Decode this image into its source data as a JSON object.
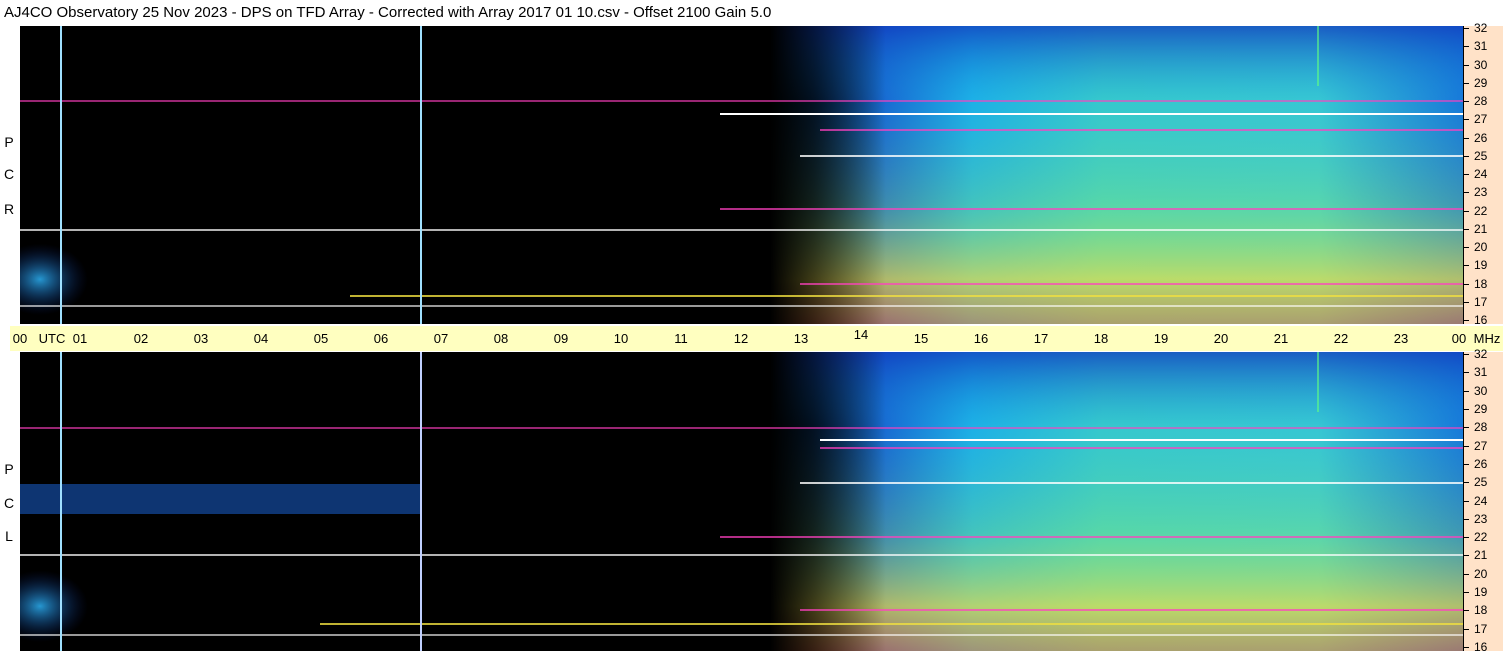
{
  "title": "AJ4CO Observatory  25 Nov 2023  -  DPS on TFD Array  -  Corrected with Array 2017 01 10.csv  -  Offset 2100  Gain 5.0",
  "panels": {
    "top": {
      "polarization_letters": [
        "R",
        "C",
        "P"
      ]
    },
    "bottom": {
      "polarization_letters": [
        "L",
        "C",
        "P"
      ]
    }
  },
  "time_axis": {
    "labels": [
      "00",
      "UTC",
      "01",
      "02",
      "03",
      "04",
      "05",
      "06",
      "07",
      "08",
      "09",
      "10",
      "11",
      "12",
      "13",
      "14",
      "15",
      "16",
      "17",
      "18",
      "19",
      "20",
      "21",
      "22",
      "23",
      "00",
      "MHz"
    ],
    "hours": [
      "00",
      "01",
      "02",
      "03",
      "04",
      "05",
      "06",
      "07",
      "08",
      "09",
      "10",
      "11",
      "12",
      "13",
      "14",
      "15",
      "16",
      "17",
      "18",
      "19",
      "20",
      "21",
      "22",
      "23",
      "00"
    ],
    "utc_label": "UTC",
    "unit_label": "MHz"
  },
  "freq_axis": {
    "labels": [
      "32",
      "31",
      "30",
      "29",
      "28",
      "27",
      "26",
      "25",
      "24",
      "23",
      "22",
      "21",
      "20",
      "19",
      "18",
      "17",
      "16"
    ],
    "min_mhz": 16,
    "max_mhz": 32
  },
  "colors": {
    "background": "#000000",
    "axis_time_bg": "#ffffc0",
    "axis_freq_bg": "#ffe2c8",
    "spectral_low": "#0a1a6a",
    "spectral_mid": "#1aa8e8",
    "spectral_high": "#e8e050",
    "saturated": "#ff40c0"
  }
}
